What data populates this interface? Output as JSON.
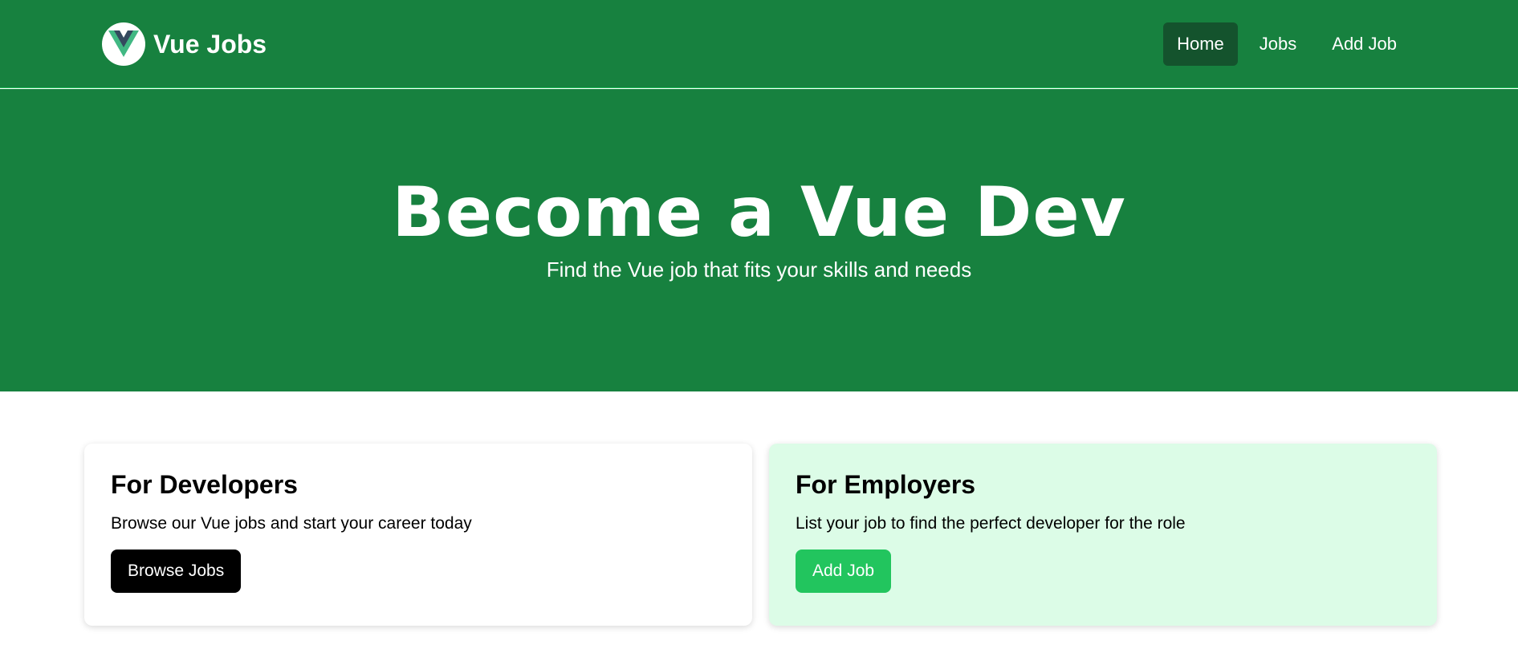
{
  "header": {
    "brand": "Vue Jobs",
    "links": [
      {
        "label": "Home",
        "active": true
      },
      {
        "label": "Jobs",
        "active": false
      },
      {
        "label": "Add Job",
        "active": false
      }
    ]
  },
  "hero": {
    "title": "Become a Vue Dev",
    "subtitle": "Find the Vue job that fits your skills and needs"
  },
  "cards": {
    "developers": {
      "title": "For Developers",
      "text": "Browse our Vue jobs and start your career today",
      "button": "Browse Jobs"
    },
    "employers": {
      "title": "For Employers",
      "text": "List your job to find the perfect developer for the role",
      "button": "Add Job"
    }
  },
  "colors": {
    "brand_green": "#17813f",
    "active_nav": "#14532d",
    "employer_card": "#dcfce7",
    "accent_button": "#22c55e"
  },
  "icons": {
    "logo": "vue-logo-icon"
  }
}
